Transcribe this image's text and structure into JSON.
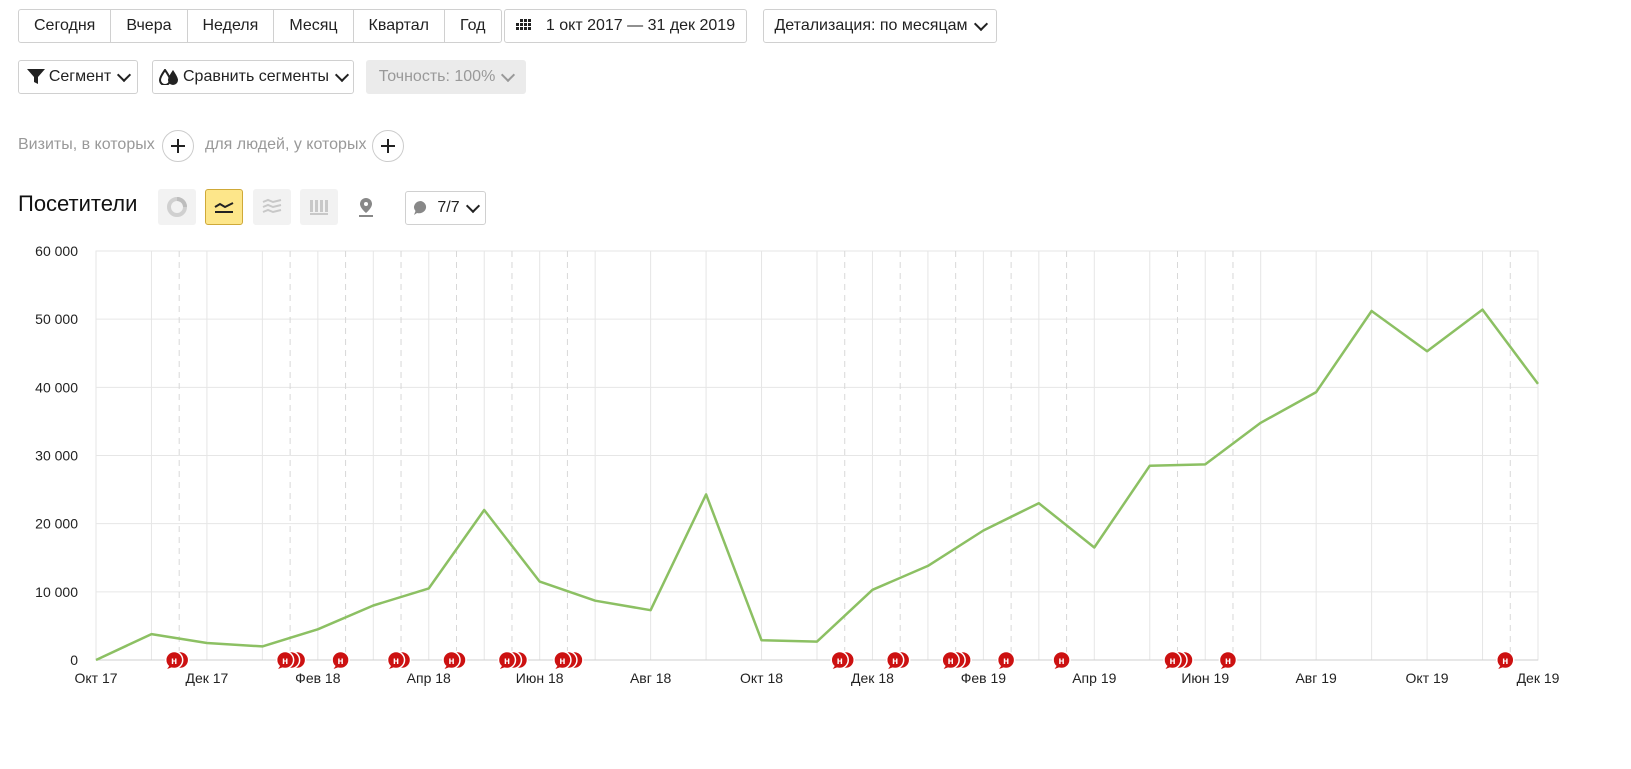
{
  "periods": [
    "Сегодня",
    "Вчера",
    "Неделя",
    "Месяц",
    "Квартал",
    "Год"
  ],
  "date_range": "1 окт 2017 — 31 дек 2019",
  "detail": "Детализация: по месяцам",
  "segment": "Сегмент",
  "compare": "Сравнить сегменты",
  "accuracy": "Точность: 100%",
  "conditions": {
    "visits": "Визиты, в которых",
    "people": "для людей, у которых"
  },
  "report_title": "Посетители",
  "notes": "7/7",
  "chart_data": {
    "type": "line",
    "x": [
      "Окт 17",
      "Ноя 17",
      "Дек 17",
      "Янв 18",
      "Фев 18",
      "Мар 18",
      "Апр 18",
      "Май 18",
      "Июн 18",
      "Июл 18",
      "Авг 18",
      "Сен 18",
      "Окт 18",
      "Ноя 18",
      "Дек 18",
      "Янв 19",
      "Фев 19",
      "Мар 19",
      "Апр 19",
      "Май 19",
      "Июн 19",
      "Июл 19",
      "Авг 19",
      "Сен 19",
      "Окт 19",
      "Ноя 19",
      "Дек 19"
    ],
    "x_tick_labels": [
      "Окт 17",
      "Дек 17",
      "Фев 18",
      "Апр 18",
      "Июн 18",
      "Авг 18",
      "Окт 18",
      "Дек 18",
      "Фев 19",
      "Апр 19",
      "Июн 19",
      "Авг 19",
      "Окт 19",
      "Дек 19"
    ],
    "y_tick_labels": [
      "0",
      "10 000",
      "20 000",
      "30 000",
      "40 000",
      "50 000",
      "60 000"
    ],
    "ylim": [
      0,
      60000
    ],
    "grid": true,
    "series": [
      {
        "color": "#8cc063",
        "values": [
          0,
          3800,
          2500,
          2000,
          4500,
          8000,
          10500,
          22000,
          11500,
          8700,
          7300,
          24300,
          2900,
          2700,
          10300,
          13800,
          19000,
          23000,
          16500,
          28500,
          28700,
          34800,
          39300,
          51200,
          45300,
          51400,
          40500
        ]
      }
    ],
    "note_marker_label": "н",
    "note_marker_color": "#cc1111",
    "note_markers_months": [
      1.5,
      3.5,
      4.5,
      5.5,
      6.5,
      7.5,
      8.5,
      13.5,
      14.5,
      15.5,
      16.5,
      17.5,
      19.5,
      20.5,
      25.5
    ],
    "note_stack_counts": [
      2,
      3,
      1,
      2,
      2,
      3,
      3,
      2,
      2,
      3,
      1,
      1,
      3,
      1,
      1
    ]
  }
}
